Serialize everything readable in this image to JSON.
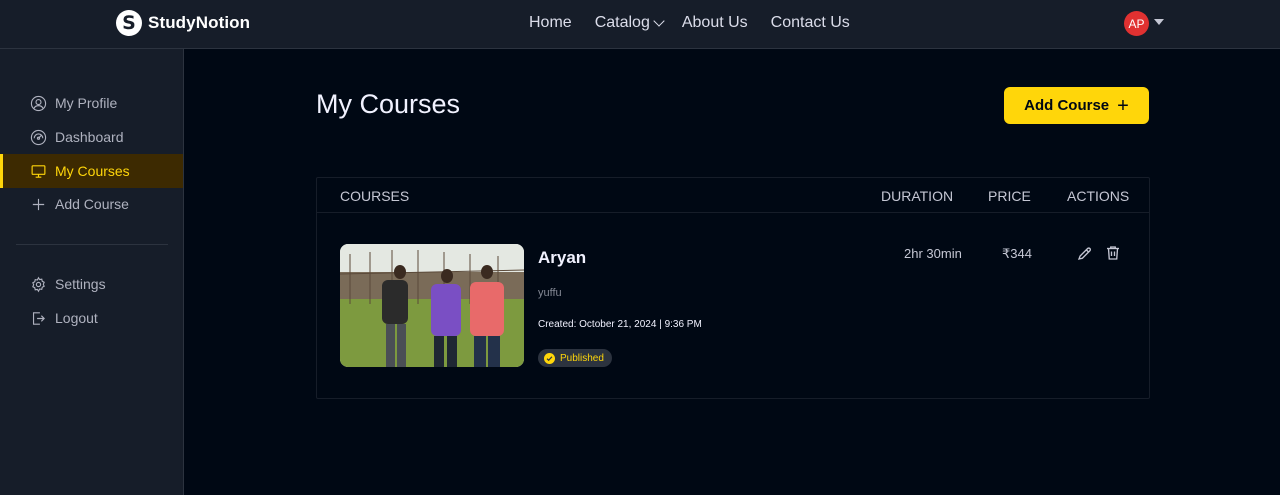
{
  "brand": {
    "name": "StudyNotion",
    "mark": "S"
  },
  "nav": {
    "links": [
      "Home",
      "Catalog",
      "About Us",
      "Contact Us"
    ]
  },
  "user": {
    "initials": "AP"
  },
  "sidebar": {
    "items": [
      {
        "label": "My Profile",
        "icon": "user-circle-icon"
      },
      {
        "label": "Dashboard",
        "icon": "gauge-icon"
      },
      {
        "label": "My Courses",
        "icon": "monitor-icon",
        "active": true
      },
      {
        "label": "Add Course",
        "icon": "plus-icon"
      },
      {
        "label": "Settings",
        "icon": "gear-icon"
      },
      {
        "label": "Logout",
        "icon": "logout-icon"
      }
    ]
  },
  "page": {
    "title": "My Courses",
    "add_course_label": "Add Course"
  },
  "table": {
    "headers": [
      "COURSES",
      "DURATION",
      "PRICE",
      "ACTIONS"
    ],
    "rows": [
      {
        "title": "Aryan",
        "description": "yuffu",
        "created": "Created: October 21, 2024 | 9:36 PM",
        "status": "Published",
        "duration": "2hr 30min",
        "price": "₹344"
      }
    ]
  },
  "colors": {
    "accent": "#FFD60A",
    "bg": "#000814",
    "panel": "#161D29",
    "avatar": "#E03131"
  }
}
